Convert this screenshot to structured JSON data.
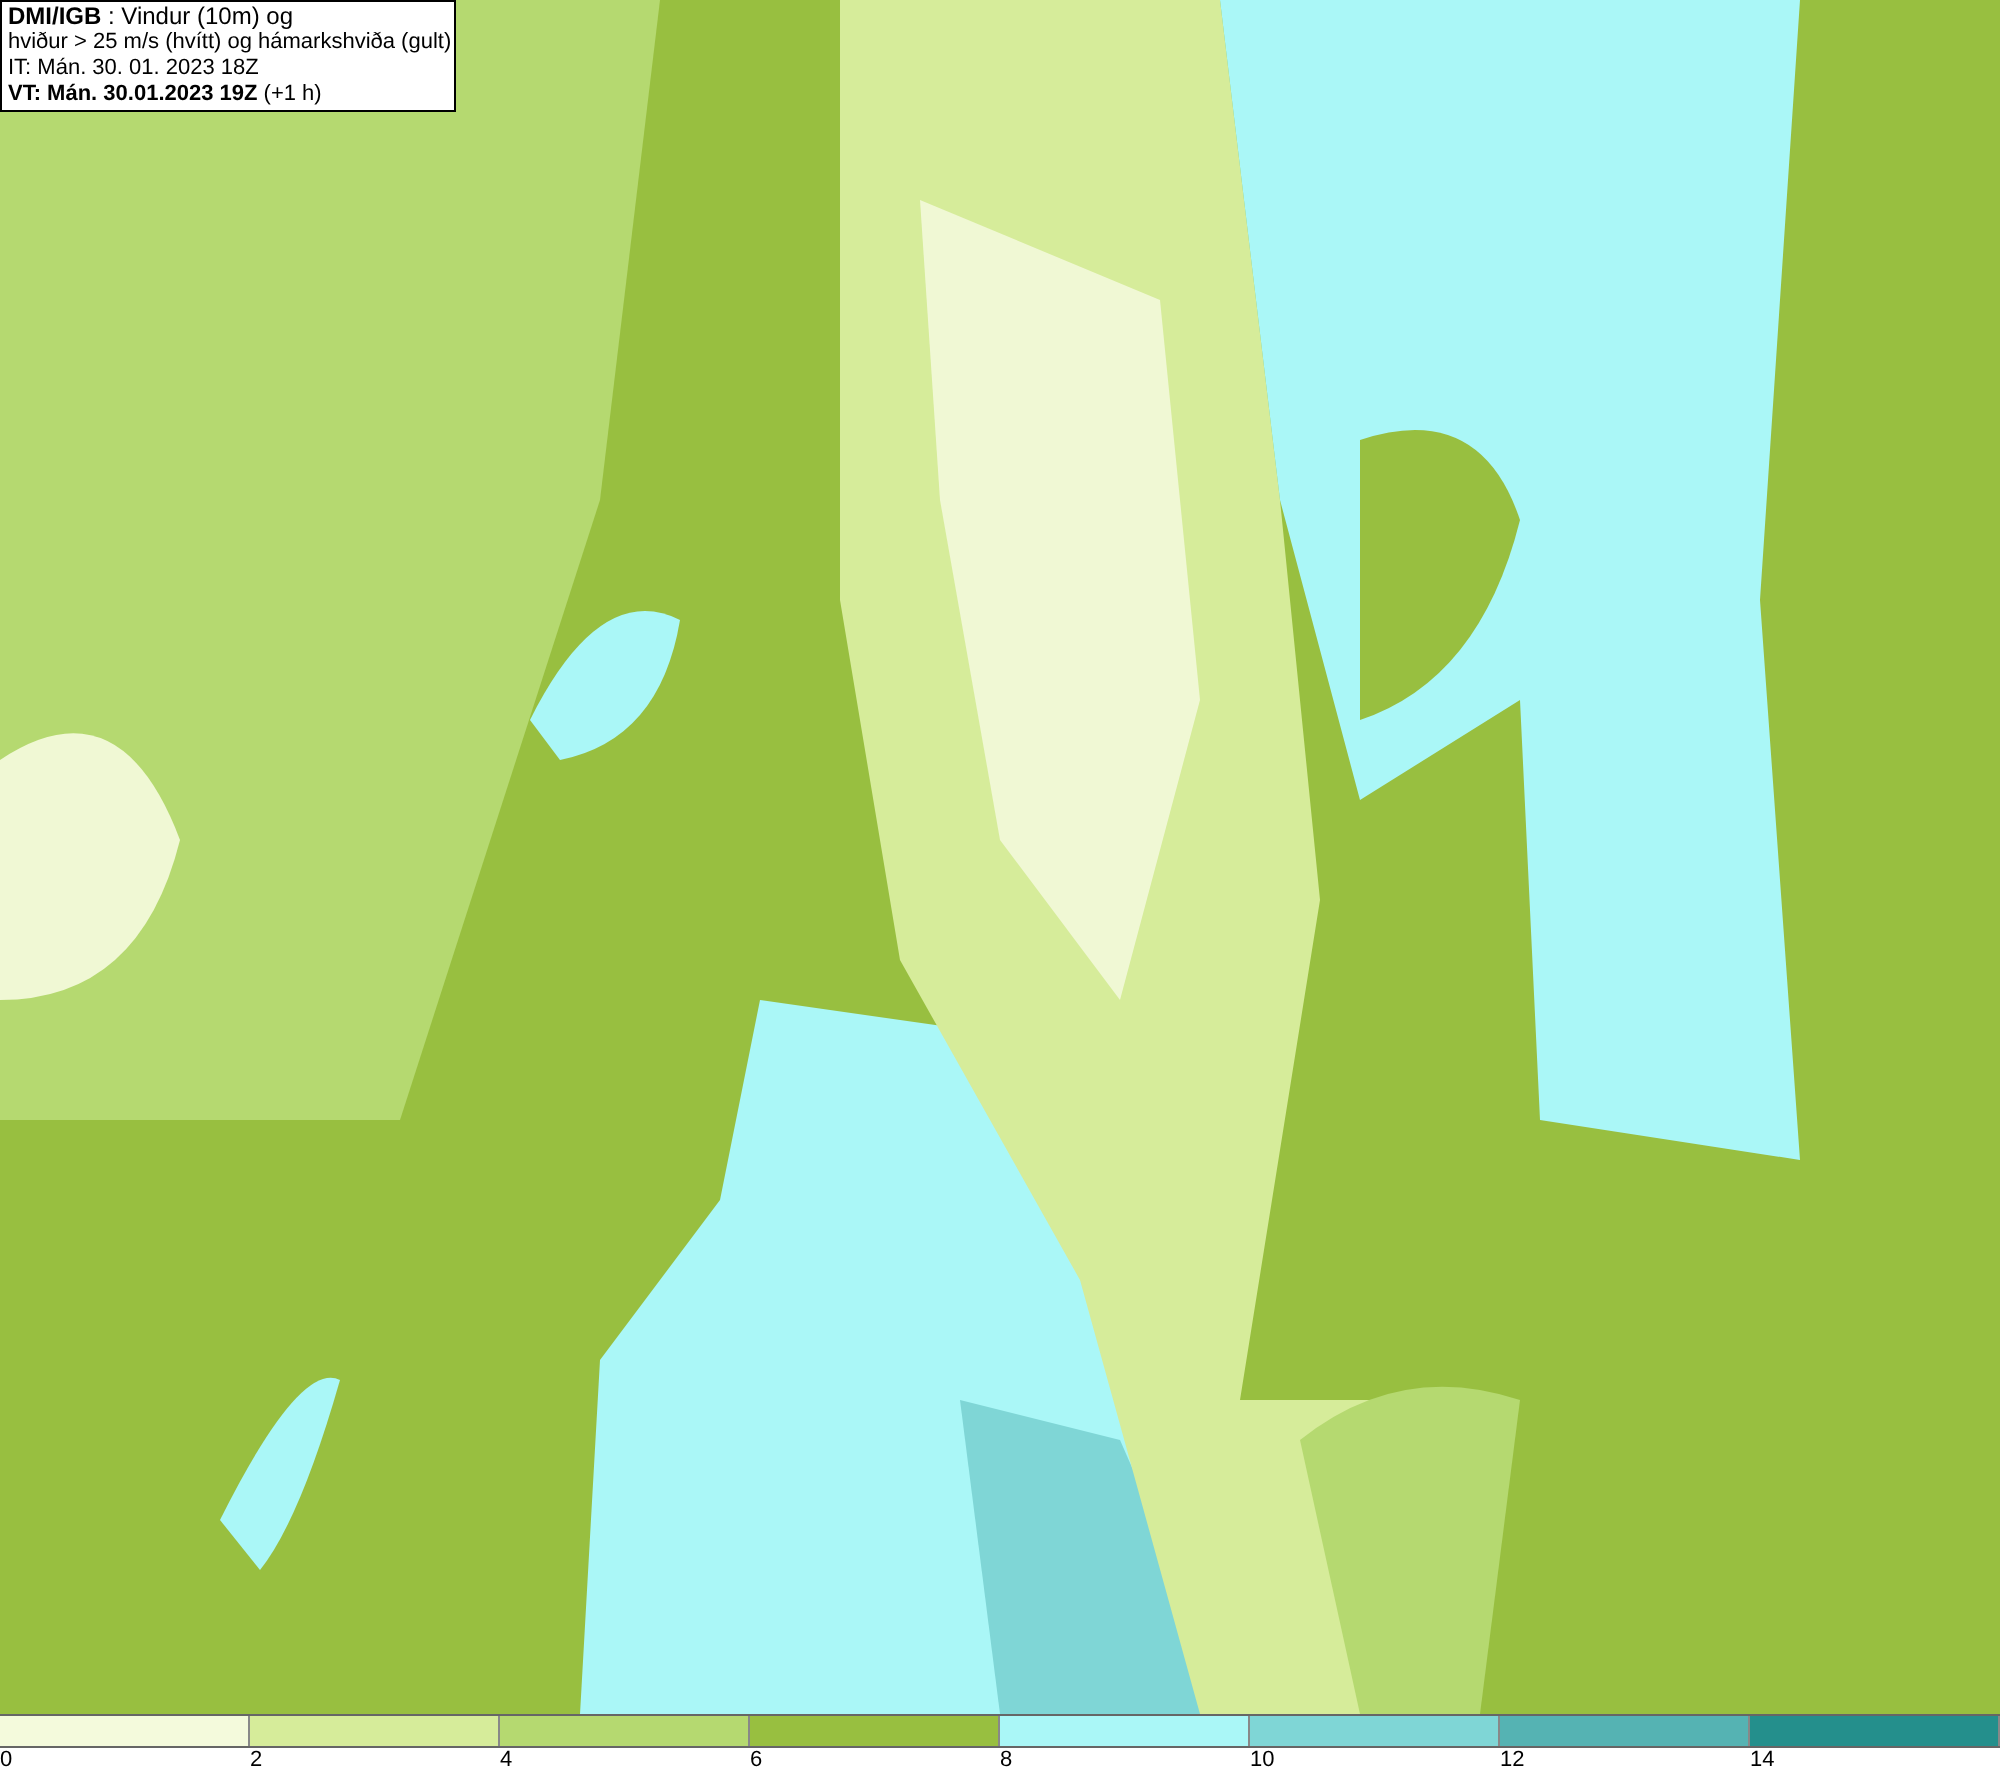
{
  "header": {
    "lines": [
      "**DMI/IGB** : Vindur (10m) og",
      "hviður > 25 m/s (hvítt) og hámarkshviða (gult)",
      "IT: Mán. 30. 01. 2023 18Z",
      "**VT: Mán. 30.01.2023 19Z** (+1 h)"
    ]
  },
  "legend": {
    "segments": [
      {
        "color": "#f4fadc"
      },
      {
        "color": "#d6ec9a"
      },
      {
        "color": "#b5d970"
      },
      {
        "color": "#98bf40"
      },
      {
        "color": "#aaf7f7"
      },
      {
        "color": "#7fd6d6"
      },
      {
        "color": "#55b3b3"
      },
      {
        "color": "#248f8c"
      }
    ],
    "labels": [
      "0",
      "2",
      "4",
      "6",
      "8",
      "10",
      "12",
      "14"
    ]
  }
}
